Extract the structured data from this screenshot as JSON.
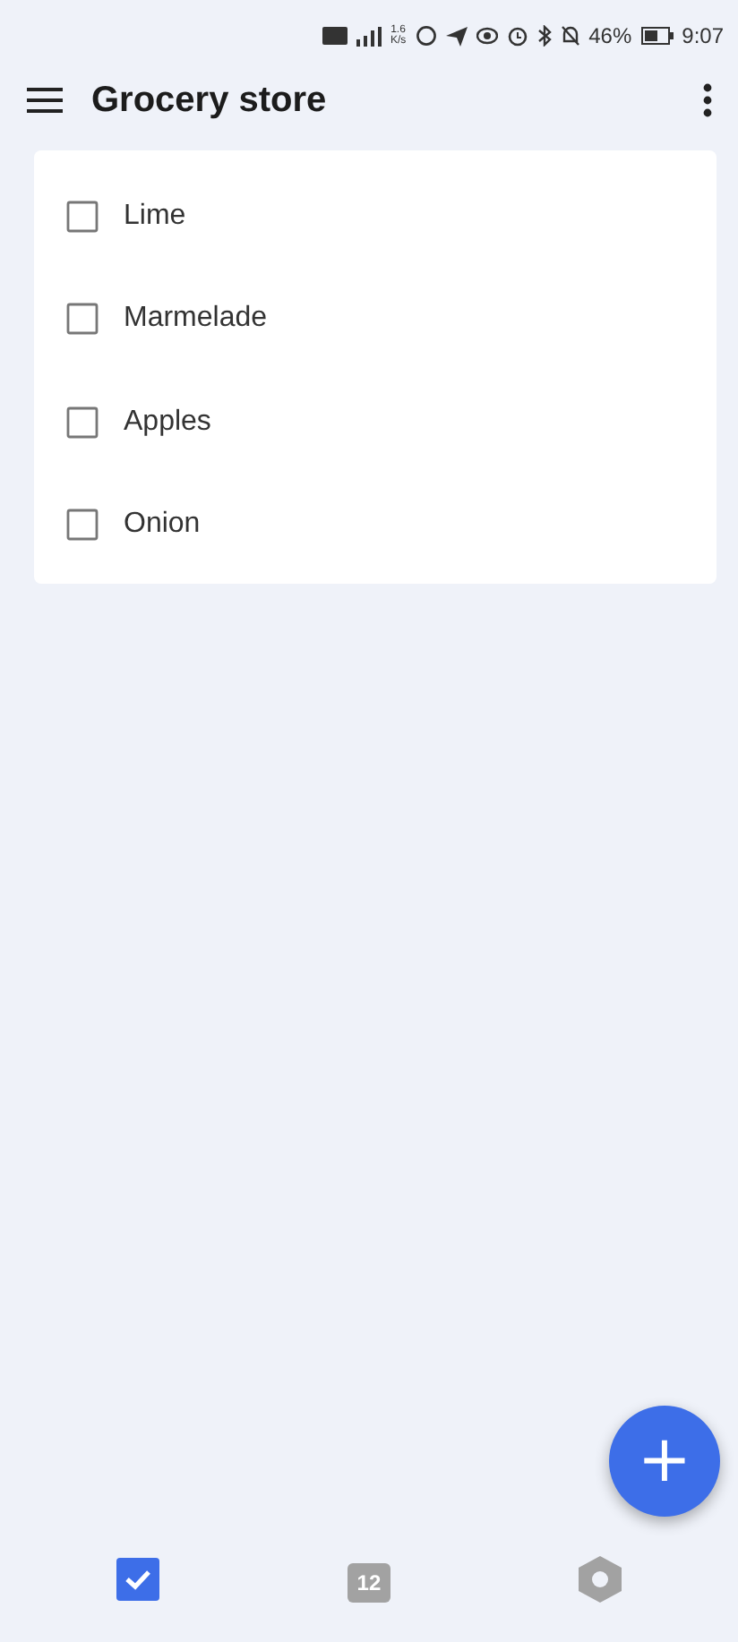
{
  "status_bar": {
    "network_speed": "1.6\nK/s",
    "battery": "46%",
    "time": "9:07"
  },
  "app_bar": {
    "title": "Grocery store"
  },
  "items": [
    {
      "label": "Lime",
      "checked": false
    },
    {
      "label": "Marmelade",
      "checked": false
    },
    {
      "label": "Apples",
      "checked": false
    },
    {
      "label": "Onion",
      "checked": false
    }
  ],
  "fab": {
    "label": "+"
  },
  "bottom_nav": [
    {
      "kind": "tasks",
      "selected": true
    },
    {
      "kind": "calendar",
      "selected": false,
      "text": "12"
    },
    {
      "kind": "settings",
      "selected": false
    }
  ]
}
